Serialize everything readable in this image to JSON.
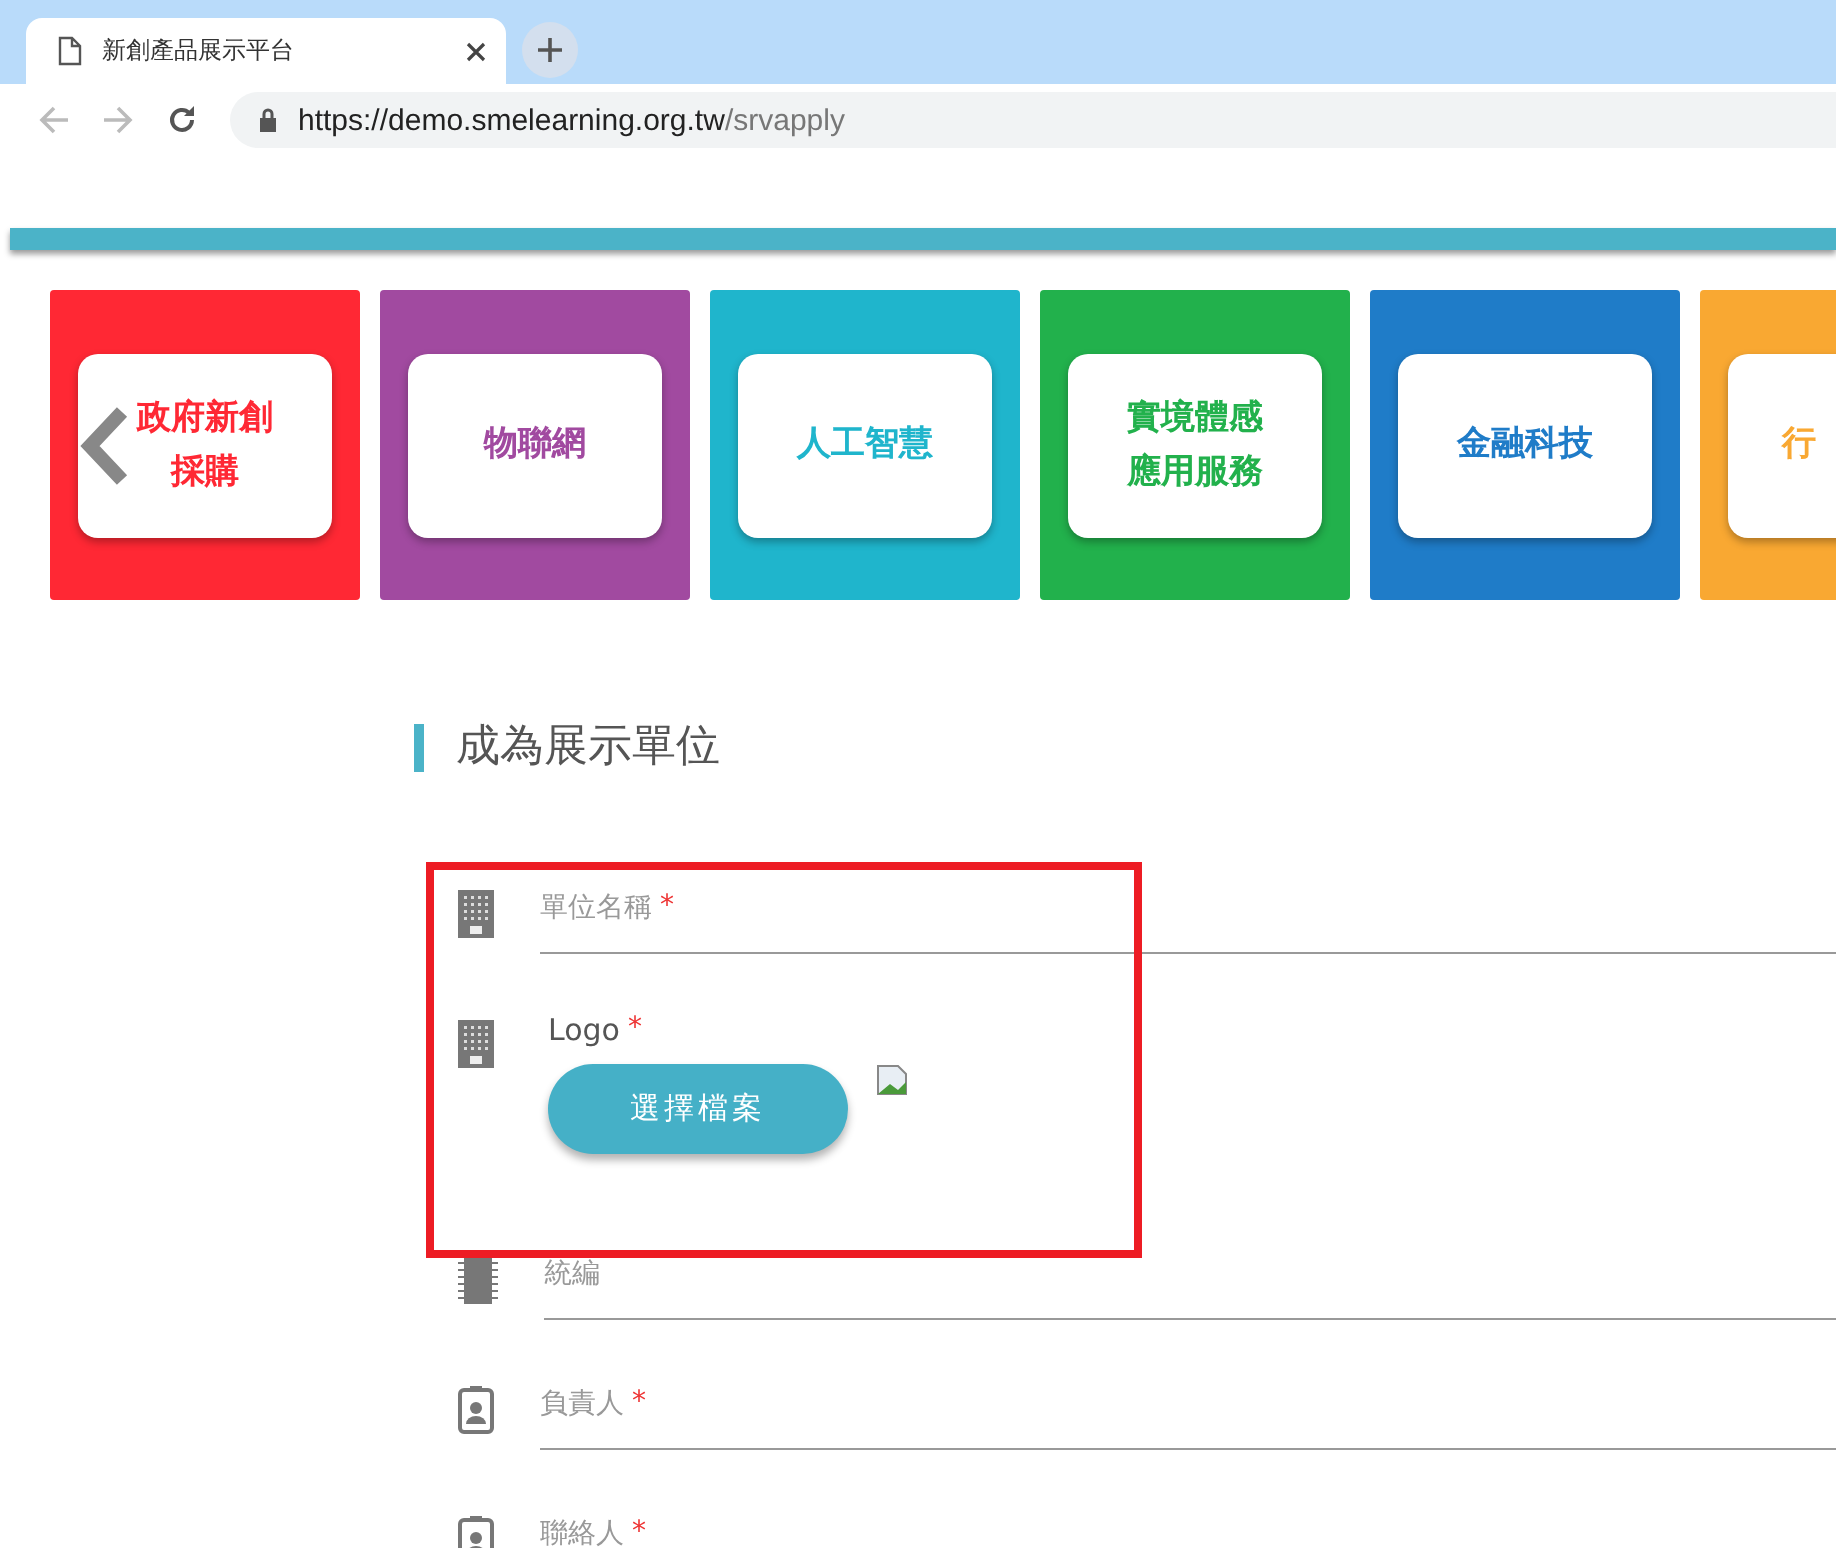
{
  "browser": {
    "tab_title": "新創產品展示平台",
    "url_host": "https://demo.smelearning.org.tw",
    "url_path": "/srvapply"
  },
  "categories": [
    {
      "lines": [
        "政府新創",
        "採購"
      ],
      "color": "#ff2834"
    },
    {
      "lines": [
        "物聯網"
      ],
      "color": "#a14aa0"
    },
    {
      "lines": [
        "人工智慧"
      ],
      "color": "#1fb5cc"
    },
    {
      "lines": [
        "實境體感",
        "應用服務"
      ],
      "color": "#22b14c"
    },
    {
      "lines": [
        "金融科技"
      ],
      "color": "#1f7cc8"
    },
    {
      "lines": [
        "行"
      ],
      "color": "#f9a832"
    }
  ],
  "section_title": "成為展示單位",
  "fields": [
    {
      "kind": "text",
      "label": "單位名稱",
      "required_mark": "*"
    },
    {
      "kind": "file",
      "label": "Logo",
      "required_mark": "*",
      "button": "選擇檔案"
    },
    {
      "kind": "text",
      "label": "統編"
    },
    {
      "kind": "text",
      "label": "負責人",
      "required_mark": "*"
    },
    {
      "kind": "text",
      "label": "聯絡人",
      "required_mark": "*"
    }
  ]
}
